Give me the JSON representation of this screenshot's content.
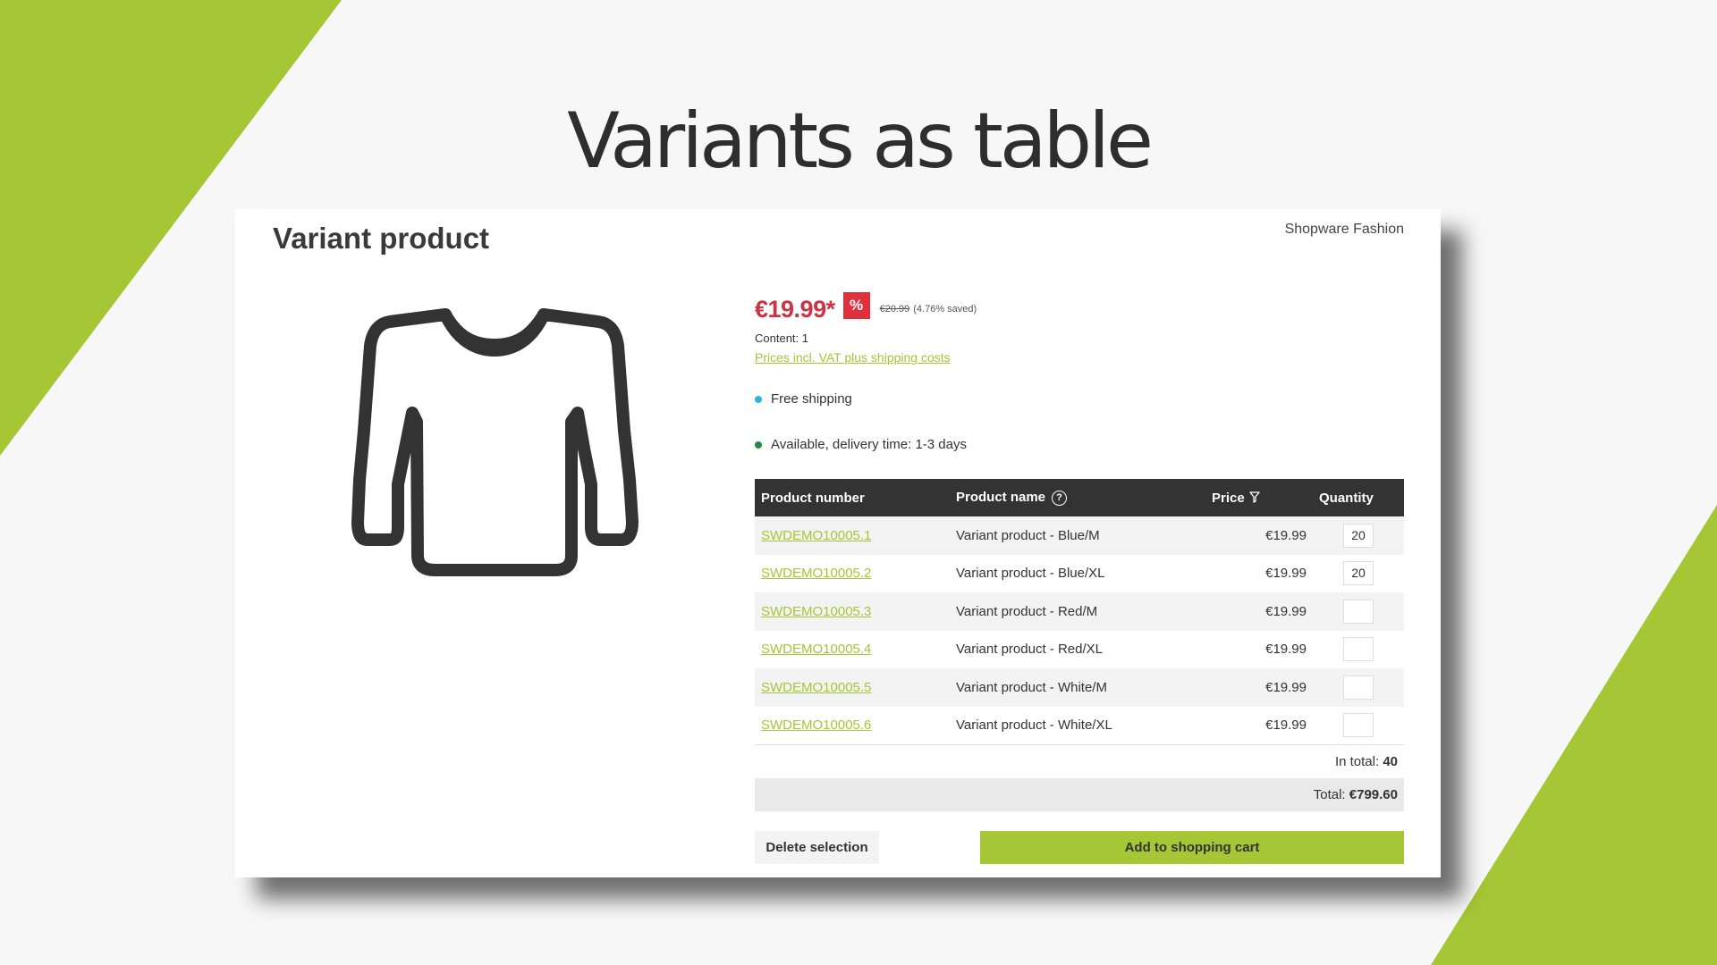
{
  "slide": {
    "title": "Variants as table"
  },
  "product": {
    "title": "Variant product",
    "manufacturer": "Shopware Fashion",
    "image_icon": "sweater-icon",
    "price": "€19.99*",
    "discount_badge": "%",
    "old_price": "€20.99",
    "saved": "(4.76% saved)",
    "content": "Content: 1",
    "vat_link": "Prices incl. VAT plus shipping costs",
    "shipping": "Free shipping",
    "availability": "Available, delivery time: 1-3 days"
  },
  "table": {
    "headers": {
      "number": "Product number",
      "name": "Product name",
      "help": "?",
      "price": "Price",
      "quantity": "Quantity"
    },
    "rows": [
      {
        "number": "SWDEMO10005.1",
        "name": "Variant product - Blue/M",
        "price": "€19.99",
        "qty": "20"
      },
      {
        "number": "SWDEMO10005.2",
        "name": "Variant product - Blue/XL",
        "price": "€19.99",
        "qty": "20"
      },
      {
        "number": "SWDEMO10005.3",
        "name": "Variant product - Red/M",
        "price": "€19.99",
        "qty": ""
      },
      {
        "number": "SWDEMO10005.4",
        "name": "Variant product - Red/XL",
        "price": "€19.99",
        "qty": ""
      },
      {
        "number": "SWDEMO10005.5",
        "name": "Variant product - White/M",
        "price": "€19.99",
        "qty": ""
      },
      {
        "number": "SWDEMO10005.6",
        "name": "Variant product - White/XL",
        "price": "€19.99",
        "qty": ""
      }
    ],
    "in_total_label": "In total:",
    "in_total_value": "40",
    "total_label": "Total:",
    "total_value": "€799.60"
  },
  "actions": {
    "delete_label": "Delete selection",
    "cart_label": "Add to shopping cart"
  },
  "colors": {
    "accent": "#a5c635",
    "price_red": "#cc3344",
    "badge_red": "#e0303c",
    "header_dark": "#333333",
    "shipping_dot": "#26b6dd",
    "available_dot": "#1f8a4c"
  }
}
